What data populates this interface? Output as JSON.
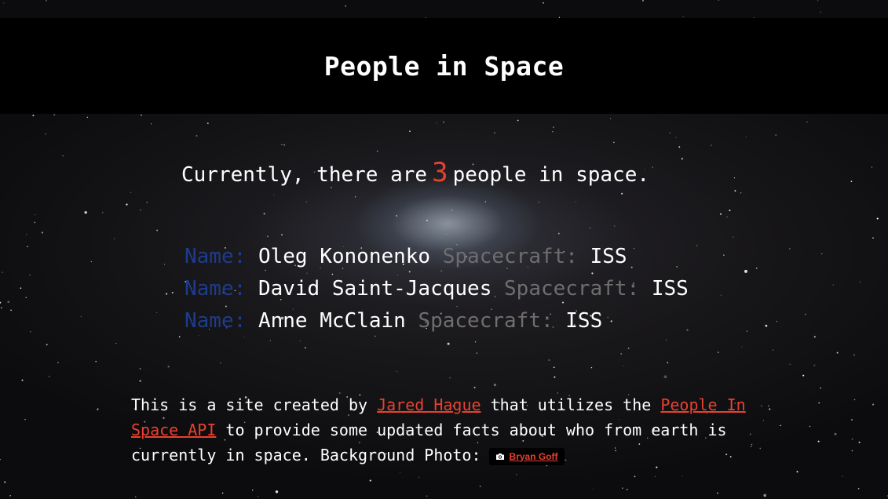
{
  "header": {
    "title": "People in Space"
  },
  "summary": {
    "prefix": "Currently, there are",
    "count": "3",
    "suffix": "people in space."
  },
  "labels": {
    "name": "Name:",
    "spacecraft": "Spacecraft:"
  },
  "people": [
    {
      "name": "Oleg Kononenko",
      "craft": "ISS"
    },
    {
      "name": "David Saint-Jacques",
      "craft": "ISS"
    },
    {
      "name": "Anne McClain",
      "craft": "ISS"
    }
  ],
  "footer": {
    "text1": "This is a site created by",
    "author_link": "Jared Hague",
    "text2": "that utilizes the",
    "api_link": "People In Space API",
    "text3": "to provide some updated facts about who from earth is currently in space. Background Photo:",
    "photo_credit": "Bryan Goff"
  },
  "colors": {
    "accent": "#e8412f",
    "name_label": "#1e3c8c",
    "spacecraft_label": "#6e6e6e",
    "header_bg": "#000000"
  },
  "icons": {
    "photo_credit": "camera-icon"
  }
}
